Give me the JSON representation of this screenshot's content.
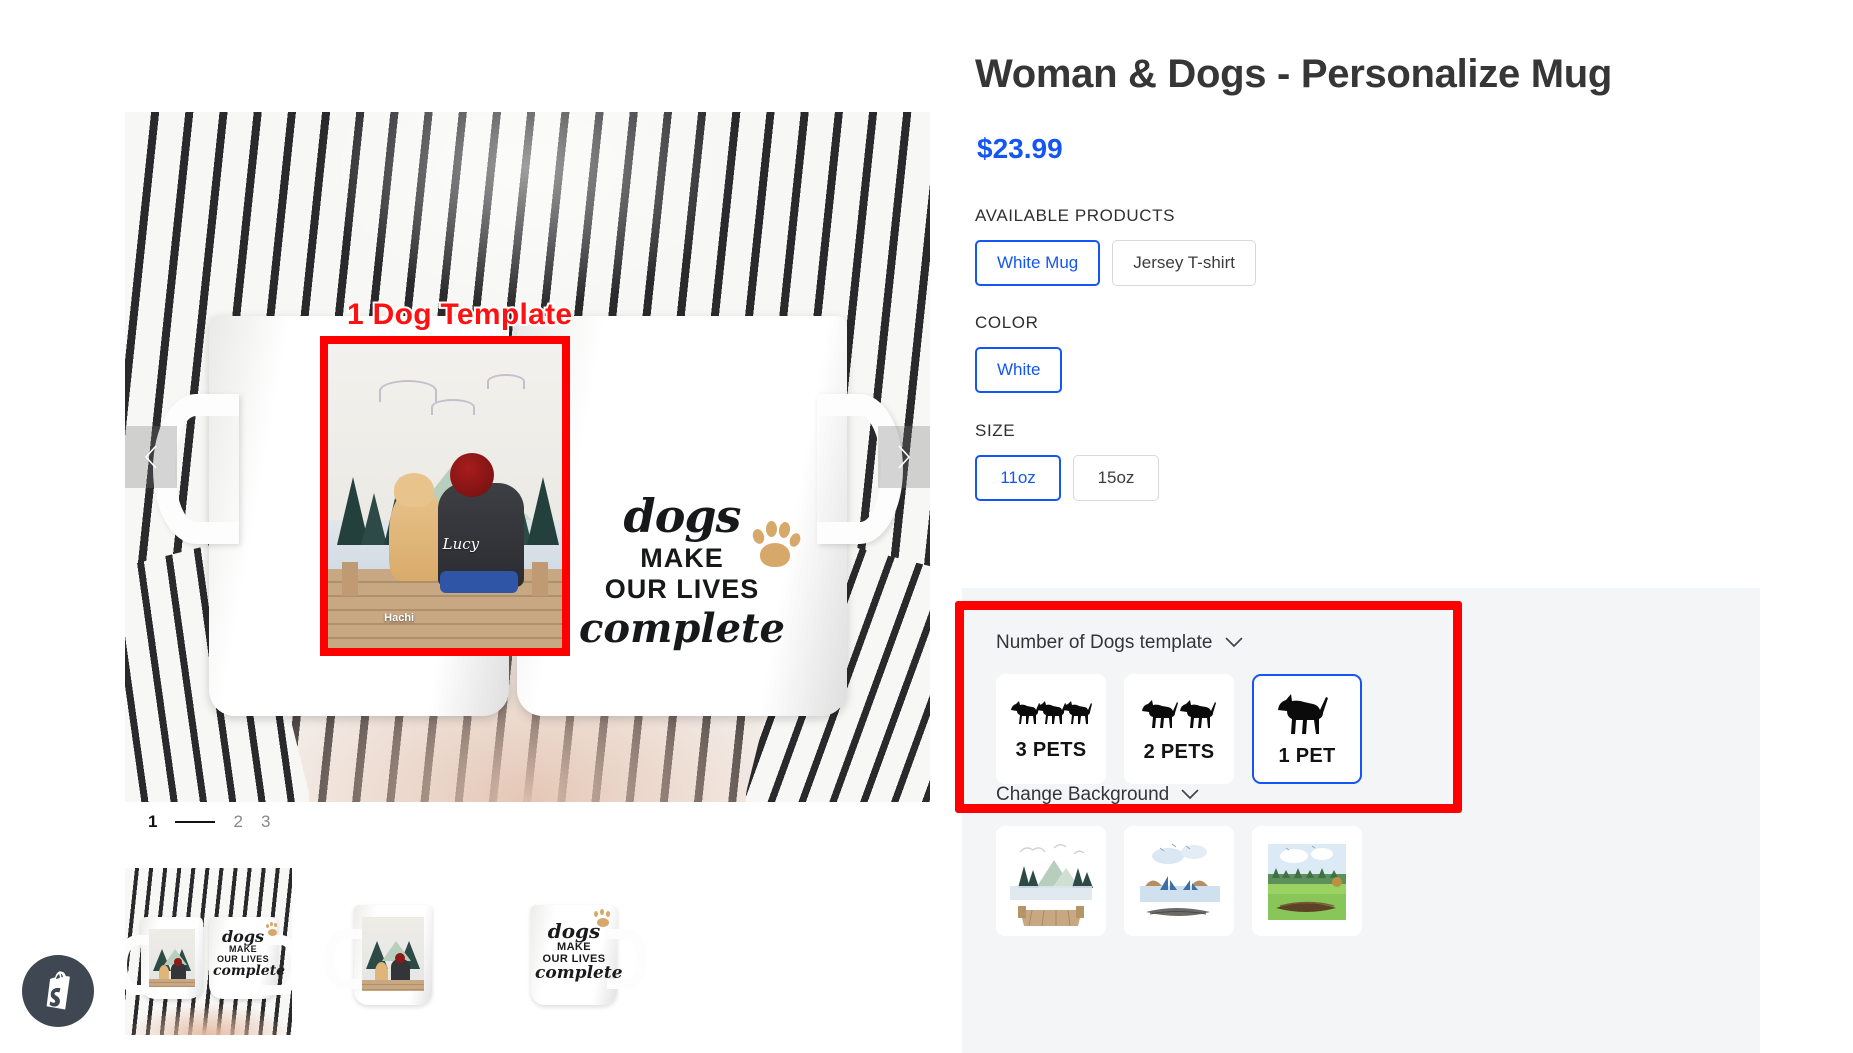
{
  "product": {
    "title": "Woman & Dogs - Personalize Mug",
    "price": "$23.99"
  },
  "options": {
    "available_products": {
      "label": "AVAILABLE PRODUCTS",
      "choices": [
        {
          "label": "White Mug",
          "selected": true
        },
        {
          "label": "Jersey T-shirt",
          "selected": false
        }
      ]
    },
    "color": {
      "label": "COLOR",
      "choices": [
        {
          "label": "White",
          "selected": true
        }
      ]
    },
    "size": {
      "label": "SIZE",
      "choices": [
        {
          "label": "11oz",
          "selected": true
        },
        {
          "label": "15oz",
          "selected": false
        }
      ]
    }
  },
  "template_section": {
    "label": "Number of Dogs template",
    "chevron": "chevron-down-icon",
    "options": [
      {
        "label": "3 PETS",
        "dogs": 3,
        "selected": false
      },
      {
        "label": "2 PETS",
        "dogs": 2,
        "selected": false
      },
      {
        "label": "1 PET",
        "dogs": 1,
        "selected": true
      }
    ]
  },
  "background_section": {
    "label": "Change Background",
    "chevron": "chevron-down-icon",
    "options": [
      {
        "name": "mountain-dock-background",
        "selected": false
      },
      {
        "name": "lake-sailboat-background",
        "selected": false
      },
      {
        "name": "meadow-log-background",
        "selected": false
      }
    ]
  },
  "gallery": {
    "annotation_label": "1 Dog Template",
    "prev_arrow": "chevron-left-icon",
    "next_arrow": "chevron-right-icon",
    "pagination": [
      {
        "label": "1",
        "active": true
      },
      {
        "label": "2",
        "active": false
      },
      {
        "label": "3",
        "active": false
      }
    ],
    "thumbnails": [
      {
        "name": "thumbnail-hands-holding-mugs",
        "active": true
      },
      {
        "name": "thumbnail-mug-artwork",
        "active": false
      },
      {
        "name": "thumbnail-mug-slogan",
        "active": false
      }
    ]
  },
  "artwork": {
    "person_name": "Lucy",
    "pet_name": "Hachi",
    "slogan": {
      "line1": "dogs",
      "line2": "MAKE",
      "line3": "OUR LIVES",
      "line4": "complete"
    }
  },
  "branding": {
    "badge": "shopify-logo-icon"
  },
  "colors": {
    "accent_blue": "#1355f5",
    "annotation_red": "#ff0000",
    "panel_gray": "#f4f5f6",
    "title_gray": "#363636",
    "paw_tan": "#d6a86a"
  }
}
